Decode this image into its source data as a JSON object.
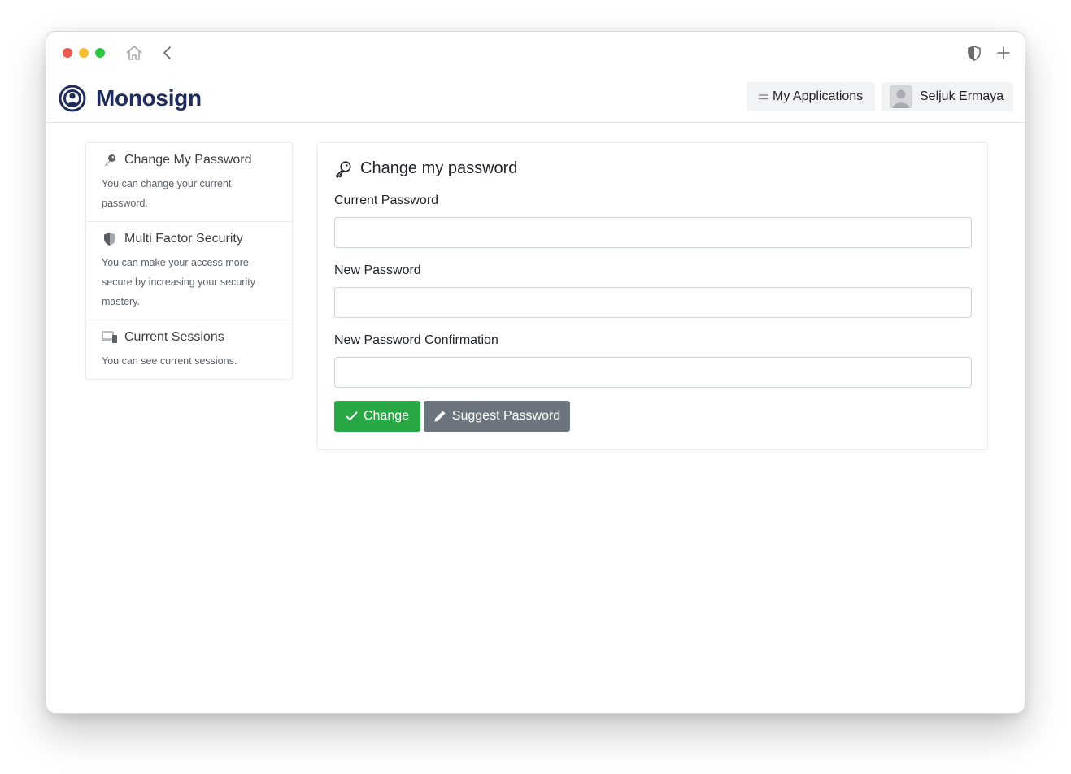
{
  "app": {
    "name": "Monosign",
    "brand_color": "#1d2c5b"
  },
  "header": {
    "apps_label": "My Applications",
    "user_name": "Seljuk Ermaya"
  },
  "sidebar": {
    "items": [
      {
        "title": "Change My Password",
        "description": "You can change your current password.",
        "icon": "key-icon"
      },
      {
        "title": "Multi Factor Security",
        "description": "You can make your access more secure by increasing your security mastery.",
        "icon": "shield-icon"
      },
      {
        "title": "Current Sessions",
        "description": "You can see current sessions.",
        "icon": "devices-icon"
      }
    ]
  },
  "form": {
    "title": "Change my password",
    "fields": [
      {
        "label": "Current Password",
        "value": "",
        "placeholder": ""
      },
      {
        "label": "New Password",
        "value": "",
        "placeholder": ""
      },
      {
        "label": "New Password Confirmation",
        "value": "",
        "placeholder": ""
      }
    ],
    "change_label": "Change",
    "suggest_label": "Suggest Password",
    "change_color": "#28a745",
    "suggest_color": "#6c757d"
  }
}
